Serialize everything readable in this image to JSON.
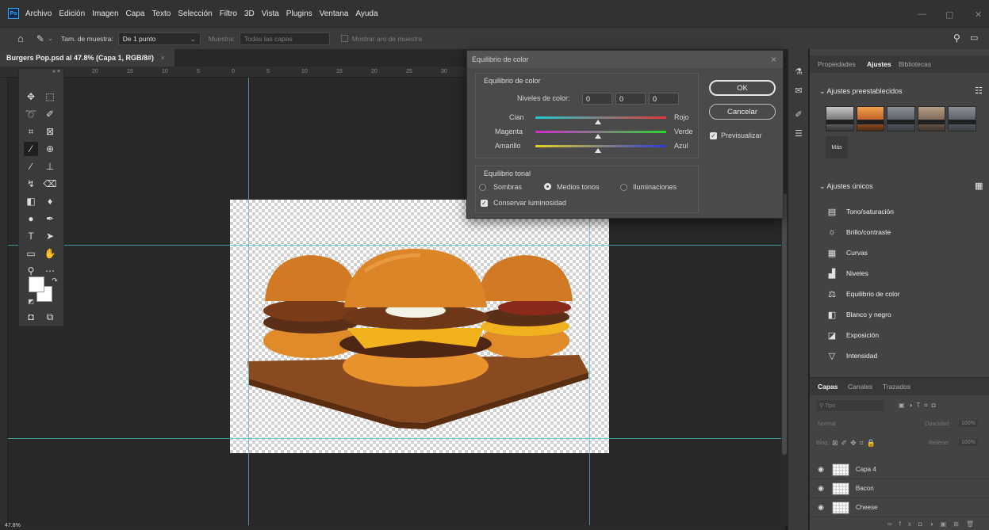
{
  "menu": [
    "Archivo",
    "Edición",
    "Imagen",
    "Capa",
    "Texto",
    "Selección",
    "Filtro",
    "3D",
    "Vista",
    "Plugins",
    "Ventana",
    "Ayuda"
  ],
  "options_bar": {
    "sample_size_label": "Tam. de muestra:",
    "sample_size_value": "De 1 punto",
    "sample_label": "Muestra:",
    "sample_value": "Todas las capas",
    "show_ring_label": "Mostrar aro de muestra"
  },
  "document": {
    "tab_title": "Burgers Pop.psd al 47.8% (Capa 1, RGB/8#)",
    "ruler_ticks": [
      "20",
      "15",
      "10",
      "5",
      "0",
      "5",
      "10",
      "15",
      "20",
      "25",
      "30"
    ]
  },
  "dialog": {
    "title": "Equilibrio de color",
    "color_balance_group": "Equilibrio de color",
    "levels_label": "Niveles de color:",
    "levels": [
      "0",
      "0",
      "0"
    ],
    "sliders": [
      {
        "left": "Cian",
        "right": "Rojo",
        "value": 0,
        "gradient": [
          "#25c8c8",
          "#e03a3a"
        ]
      },
      {
        "left": "Magenta",
        "right": "Verde",
        "value": 0,
        "gradient": [
          "#d22bd2",
          "#2ed62e"
        ]
      },
      {
        "left": "Amarillo",
        "right": "Azul",
        "value": 0,
        "gradient": [
          "#e6d422",
          "#2c3bd6"
        ]
      }
    ],
    "tonal_group": "Equilibrio tonal",
    "tones": [
      "Sombras",
      "Medios tonos",
      "Iluminaciones"
    ],
    "selected_tone": "Medios tonos",
    "preserve_label": "Conservar luminosidad",
    "ok_label": "OK",
    "cancel_label": "Cancelar",
    "preview_label": "Previsualizar"
  },
  "right_panel": {
    "tabs": [
      "Propiedades",
      "Ajustes",
      "Bibliotecas"
    ],
    "active_tab": "Ajustes",
    "presets_section": "Ajustes preestablecidos",
    "more_label": "Más",
    "single_section": "Ajustes únicos",
    "adjustments": [
      "Tono/saturación",
      "Brillo/contraste",
      "Curvas",
      "Niveles",
      "Equilibrio de color",
      "Blanco y negro",
      "Exposición",
      "Intensidad"
    ]
  },
  "layers_panel": {
    "tabs": [
      "Capas",
      "Canales",
      "Trazados"
    ],
    "search_placeholder": "Tipo",
    "blend_mode": "Normal",
    "opacity_label": "Opacidad:",
    "opacity_value": "100%",
    "lock_label": "Bloq.:",
    "fill_label": "Relleno:",
    "fill_value": "100%",
    "layers": [
      "Capa 4",
      "Bacon",
      "Cheese"
    ]
  },
  "status": {
    "zoom": "47.8%"
  },
  "colors": {
    "guide": "#3fc1c9",
    "accent": "#31a8ff"
  }
}
